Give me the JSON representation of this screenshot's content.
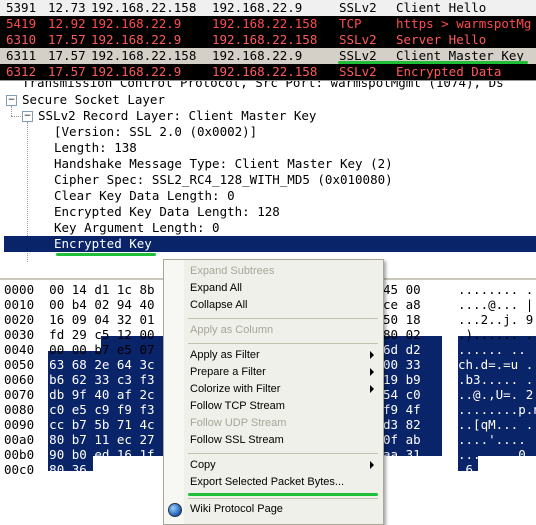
{
  "packets": [
    {
      "no": "5391",
      "time": "12.73",
      "src": "192.168.22.158",
      "dst": "192.168.22.9",
      "proto": "SSLv2",
      "info": "Client Hello",
      "bg": "#f0f0f0",
      "fg": "#000000"
    },
    {
      "no": "5419",
      "time": "12.92",
      "src": "192.168.22.9",
      "dst": "192.168.22.158",
      "proto": "TCP",
      "info": "https > warmspotMg",
      "bg": "#000000",
      "fg": "#ff4b4b"
    },
    {
      "no": "6310",
      "time": "17.57",
      "src": "192.168.22.9",
      "dst": "192.168.22.158",
      "proto": "SSLv2",
      "info": "Server Hello",
      "bg": "#000000",
      "fg": "#ff5a5a"
    },
    {
      "no": "6311",
      "time": "17.57",
      "src": "192.168.22.158",
      "dst": "192.168.22.9",
      "proto": "SSLv2",
      "info": "Client Master Key",
      "bg": "#d4d0c8",
      "fg": "#000000"
    },
    {
      "no": "6312",
      "time": "17.57",
      "src": "192.168.22.9",
      "dst": "192.168.22.158",
      "proto": "SSLv2",
      "info": "Encrypted Data",
      "bg": "#000000",
      "fg": "#ff5a5a"
    }
  ],
  "tree": {
    "tcp_row": "Transmission Control Protocol, Src Port: warmspotMgmt (1074), Ds",
    "ssl_row": "Secure Socket Layer",
    "record_row": "SSLv2 Record Layer: Client Master Key",
    "fields": [
      "[Version: SSL 2.0 (0x0002)]",
      "Length: 138",
      "Handshake Message Type: Client Master Key (2)",
      "Cipher Spec: SSL2_RC4_128_WITH_MD5 (0x010080)",
      "Clear Key Data Length: 0",
      "Encrypted Key Data Length: 128",
      "Key Argument Length: 0"
    ],
    "selected_field": "Encrypted Key"
  },
  "bytes": [
    {
      "off": "0000",
      "hex": "00 14 d1 1c 8b",
      "tail": "45 00",
      "ascii": "........ ."
    },
    {
      "off": "0010",
      "hex": "00 b4 02 94 40",
      "tail": "ce a8",
      "ascii": "....@... |"
    },
    {
      "off": "0020",
      "hex": "16 09 04 32 01",
      "tail": "50 18",
      "ascii": "...2..j. 9"
    },
    {
      "off": "0030",
      "hex": "fd 29 c5 12 00",
      "tail": "80 02",
      "ascii": ".)...... ."
    },
    {
      "off": "0040",
      "hex": "00 00 b7 e5 07",
      "tail": "6d d2",
      "ascii": "...... .."
    },
    {
      "off": "0050",
      "hex": "63 68 2e 64 3c",
      "tail": "00 33",
      "ascii": "ch.d=.=u ."
    },
    {
      "off": "0060",
      "hex": "b6 62 33 c3 f3",
      "tail": "19 b9",
      "ascii": ".b3..... ."
    },
    {
      "off": "0070",
      "hex": "db 9f 40 af 2c",
      "tail": "54 c0",
      "ascii": "..@.,U=. 2"
    },
    {
      "off": "0080",
      "hex": "c0 e5 c9 f9 f3",
      "tail": "f9 4f",
      "ascii": "........p.n"
    },
    {
      "off": "0090",
      "hex": "cc b7 5b 71 4c",
      "tail": "d3 82",
      "ascii": "..[qM... ."
    },
    {
      "off": "00a0",
      "hex": "80 b7 11 ec 27",
      "tail": "0f ab",
      "ascii": "....'.... ."
    },
    {
      "off": "00b0",
      "hex": "90 b0 ed 16 1f",
      "tail": "aa 31",
      "ascii": "........0 ."
    },
    {
      "off": "00c0",
      "hex": "80 36",
      "tail": "",
      "ascii": ".6"
    }
  ],
  "menu": {
    "items": [
      {
        "label": "Expand Subtrees",
        "disabled": true
      },
      {
        "label": "Expand All",
        "disabled": false
      },
      {
        "label": "Collapse All",
        "disabled": false
      },
      {
        "label": "Apply as Column",
        "disabled": true
      },
      {
        "label": "Apply as Filter",
        "disabled": false,
        "submenu": true
      },
      {
        "label": "Prepare a Filter",
        "disabled": false,
        "submenu": true
      },
      {
        "label": "Colorize with Filter",
        "disabled": false,
        "submenu": true
      },
      {
        "label": "Follow TCP Stream",
        "disabled": false
      },
      {
        "label": "Follow UDP Stream",
        "disabled": true
      },
      {
        "label": "Follow SSL Stream",
        "disabled": false
      },
      {
        "label": "Copy",
        "disabled": false,
        "submenu": true
      },
      {
        "label": "Export Selected Packet Bytes...",
        "disabled": false
      },
      {
        "label": "Wiki Protocol Page",
        "disabled": false
      }
    ]
  },
  "colors": {
    "selection": "#0a246a",
    "underline": "#1fbf3a",
    "menu_bg": "#f0f0ea"
  }
}
